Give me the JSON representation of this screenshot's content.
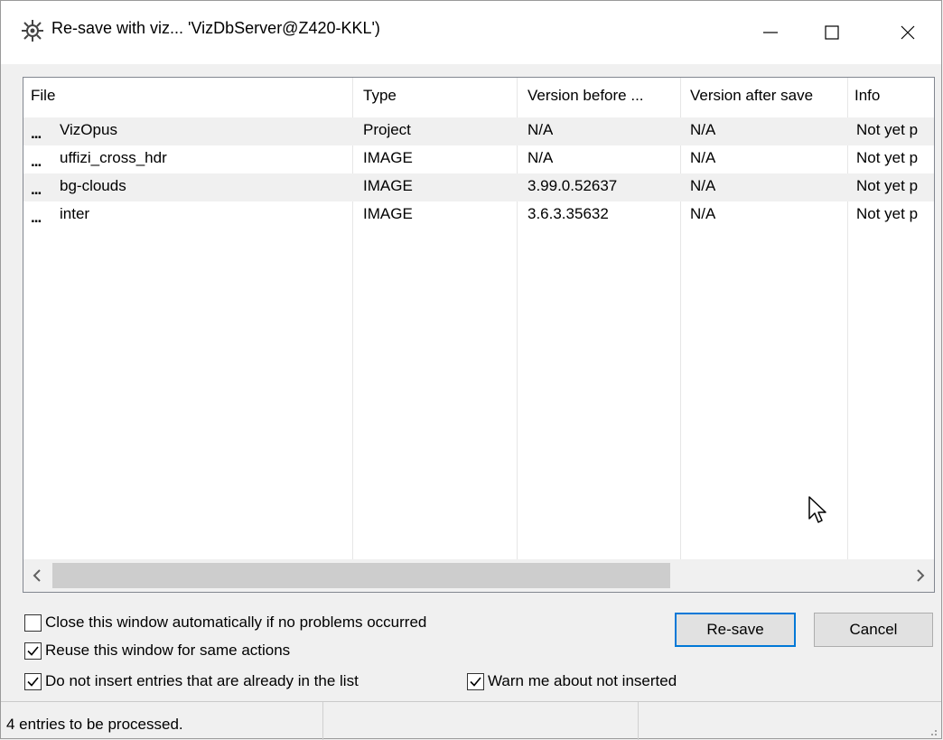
{
  "window": {
    "title": "Re-save with viz... 'VizDbServer@Z420-KKL')",
    "icon": "gear-icon"
  },
  "list": {
    "columns": [
      "File",
      "Type",
      "Version before ...",
      "Version after save",
      "Info"
    ],
    "rows": [
      {
        "file": "VizOpus",
        "type": "Project",
        "before": "N/A",
        "after": "N/A",
        "info": "Not yet p"
      },
      {
        "file": "uffizi_cross_hdr",
        "type": "IMAGE",
        "before": "N/A",
        "after": "N/A",
        "info": "Not yet p"
      },
      {
        "file": "bg-clouds",
        "type": "IMAGE",
        "before": "3.99.0.52637",
        "after": "N/A",
        "info": "Not yet p"
      },
      {
        "file": "inter",
        "type": "IMAGE",
        "before": "3.6.3.35632",
        "after": "N/A",
        "info": "Not yet p"
      }
    ],
    "row_marker": "..."
  },
  "options": {
    "close_auto": {
      "label": "Close this window automatically if no problems occurred",
      "checked": false
    },
    "reuse": {
      "label": "Reuse this window for same actions",
      "checked": true
    },
    "no_dupes": {
      "label": "Do not insert entries that are already in the list",
      "checked": true
    },
    "warn": {
      "label": "Warn me about not inserted",
      "checked": true
    }
  },
  "buttons": {
    "resave": "Re-save",
    "cancel": "Cancel"
  },
  "status": {
    "text": "4 entries to be processed."
  }
}
